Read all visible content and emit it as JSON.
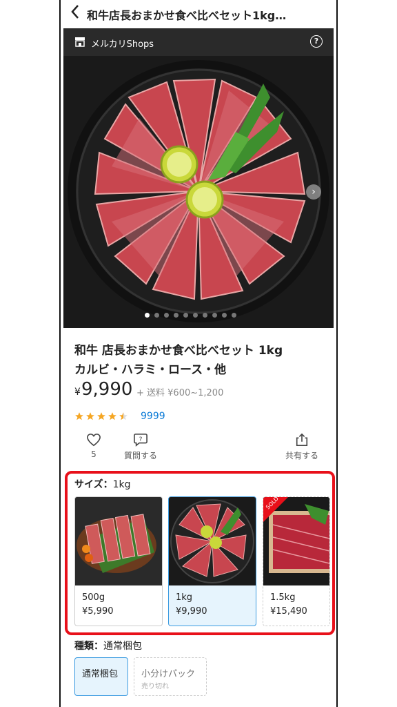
{
  "header": {
    "title": "和牛店長おまかせ食べ比べセット1kg…"
  },
  "shop": {
    "name": "メルカリShops"
  },
  "product": {
    "title_line1": "和牛 店長おまかせ食べ比べセット 1kg",
    "title_line2": "カルビ・ハラミ・ロース・他",
    "currency": "¥",
    "price": "9,990",
    "shipping": "+ 送料 ¥600~1,200",
    "rating": 4.5,
    "rating_count": "9999",
    "images_total": 10,
    "image_index": 1
  },
  "actions": {
    "like_count": "5",
    "question_label": "質問する",
    "share_label": "共有する"
  },
  "size": {
    "label": "サイズ：",
    "selected": "1kg",
    "options": [
      {
        "weight": "500g",
        "price": "¥5,990"
      },
      {
        "weight": "1kg",
        "price": "¥9,990"
      },
      {
        "weight": "1.5kg",
        "price": "¥15,490",
        "badge": "SOLD"
      }
    ]
  },
  "packaging": {
    "label": "種類：",
    "selected": "通常梱包",
    "options": [
      {
        "label": "通常梱包"
      },
      {
        "label": "小分けパック",
        "status": "売り切れ"
      }
    ]
  },
  "colors": {
    "accent": "#3a9ae0",
    "highlight": "#e8101a",
    "star": "#f5a623",
    "link": "#0a7ad6"
  }
}
